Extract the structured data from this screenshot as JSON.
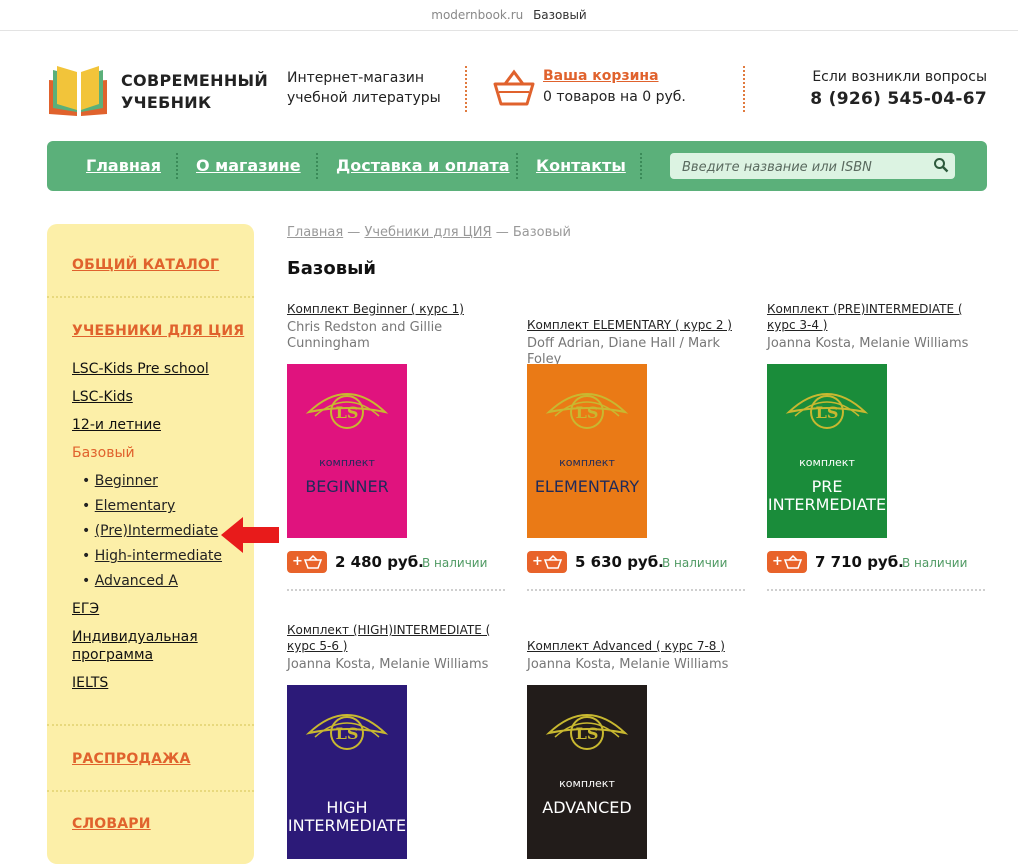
{
  "browser": {
    "url": "modernbook.ru",
    "tab_title": "Базовый"
  },
  "header": {
    "logo_line1": "СОВРЕМЕННЫЙ",
    "logo_line2": "УЧЕБНИК",
    "slogan_line1": "Интернет-магазин",
    "slogan_line2": "учебной литературы",
    "cart_label": "Ваша корзина",
    "cart_count": "0 товаров на 0 руб.",
    "contact_label": "Если возникли вопросы",
    "phone": "8 (926) 545-04-67"
  },
  "nav": {
    "items": [
      "Главная",
      "О магазине",
      "Доставка и оплата",
      "Контакты"
    ],
    "search_placeholder": "Введите название или ISBN"
  },
  "sidebar": {
    "general_catalog": "ОБЩИЙ КАТАЛОГ",
    "cia_books": "УЧЕБНИКИ ДЛЯ ЦИЯ",
    "links": [
      "LSC-Kids Pre school",
      "LSC-Kids",
      "12-и летние"
    ],
    "active": "Базовый",
    "sub": [
      "Beginner",
      "Elementary",
      "(Pre)Intermediate",
      "High-intermediate",
      "Advanced A"
    ],
    "after": [
      "ЕГЭ",
      "Индивидуальная",
      "программа",
      "IELTS"
    ],
    "sale": "РАСПРОДАЖА",
    "dictionaries": "СЛОВАРИ"
  },
  "breadcrumb": {
    "home": "Главная",
    "sep": "—",
    "section": "Учебники для ЦИЯ",
    "current": "Базовый"
  },
  "page_title": "Базовый",
  "products": [
    {
      "title": "Комплект Beginner ( курс 1)",
      "author": "Chris Redston and Gillie Cunningham",
      "cover_word": "комплект",
      "cover_name": "BEGINNER",
      "cover_name2": "",
      "color": "#e0137e",
      "price": "2 480 руб.",
      "stock": "В наличии"
    },
    {
      "title": "Комплект ELEMENTARY ( курс 2 )",
      "author": "Doff Adrian, Diane Hall / Mark Foley",
      "cover_word": "комплект",
      "cover_name": "ELEMENTARY",
      "cover_name2": "",
      "color": "#ea7a16",
      "price": "5 630 руб.",
      "stock": "В наличии"
    },
    {
      "title": "Комплект (PRE)INTERMEDIATE ( курс 3-4 )",
      "author": "Joanna Kosta, Melanie Williams",
      "cover_word": "комплект",
      "cover_name": "PRE",
      "cover_name2": "INTERMEDIATE",
      "color": "#1a8c3a",
      "price": "7 710 руб.",
      "stock": "В наличии"
    },
    {
      "title": "Комплект (HIGH)INTERMEDIATE ( курс 5-6 )",
      "author": "Joanna Kosta, Melanie Williams",
      "cover_word": "",
      "cover_name": "HIGH",
      "cover_name2": "INTERMEDIATE",
      "color": "#2c1a78",
      "price": "",
      "stock": ""
    },
    {
      "title": "Комплект Advanced ( курс 7-8 )",
      "author": "Joanna Kosta, Melanie Williams",
      "cover_word": "комплект",
      "cover_name": "ADVANCED",
      "cover_name2": "",
      "color": "#221c1a",
      "price": "",
      "stock": ""
    }
  ],
  "buy_button": "+"
}
